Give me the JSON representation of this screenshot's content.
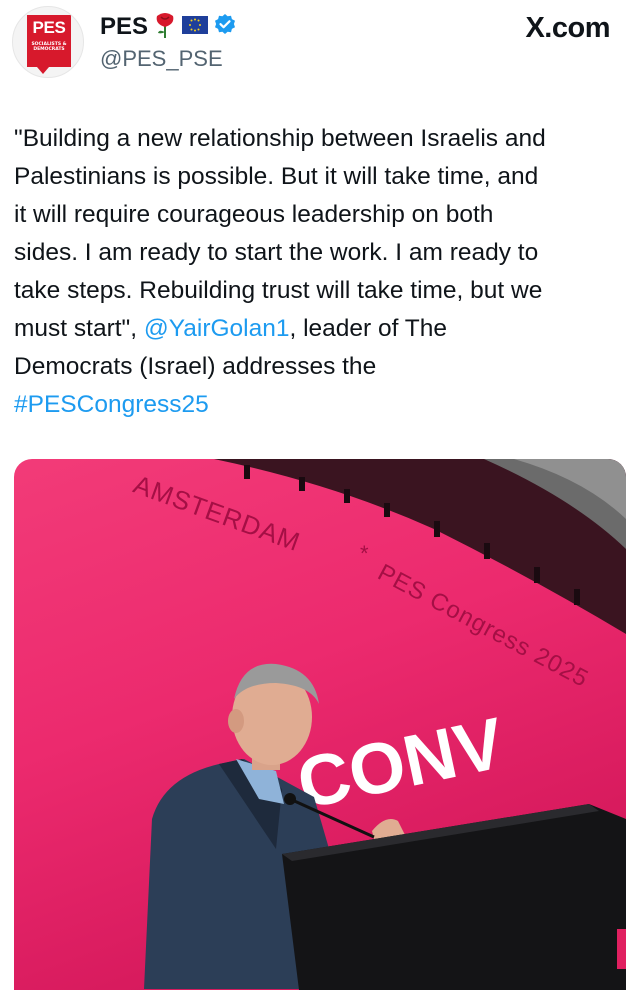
{
  "account": {
    "display_name": "PES",
    "handle": "@PES_PSE",
    "avatar_logo_text": "PES",
    "avatar_logo_subtext": "SOCIALISTS & DEMOCRATS",
    "verified": true
  },
  "brand": {
    "site_label": "X.com"
  },
  "tweet": {
    "lines": [
      "\"Building a new relationship between Israelis and",
      "Palestinians is possible. But it will take time, and",
      "it will require courageous leadership on both",
      "sides. I am ready to start the work. I am ready to",
      "take steps. Rebuilding trust will take time, but we"
    ],
    "line6_before": "must start\", ",
    "mention": "@YairGolan1",
    "line6_after": ", leader of The",
    "line7": "Democrats (Israel) addresses the",
    "hashtag": "#PESCongress25"
  },
  "media": {
    "banner_left": "AMSTERDAM",
    "banner_star": "*",
    "banner_right": "PES Congress 2025",
    "screen_text": "CONV"
  },
  "colors": {
    "link": "#1d9bf0",
    "pes_red": "#d7192c",
    "stage_pink": "#ec2a6e",
    "verified_blue": "#1d9bf0"
  }
}
